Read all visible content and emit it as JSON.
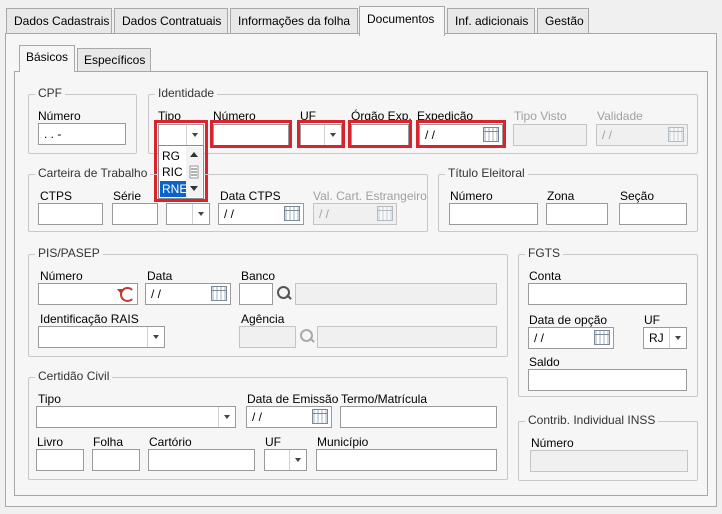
{
  "tabs": [
    {
      "label": "Dados Cadastrais"
    },
    {
      "label": "Dados Contratuais"
    },
    {
      "label": "Informações da folha"
    },
    {
      "label": "Documentos"
    },
    {
      "label": "Inf. adicionais"
    },
    {
      "label": "Gestão"
    }
  ],
  "active_tab": "Documentos",
  "subtabs": [
    {
      "label": "Básicos"
    },
    {
      "label": "Específicos"
    }
  ],
  "active_subtab": "Básicos",
  "cpf": {
    "title": "CPF",
    "numero_label": "Número",
    "numero_value": " .  .  -"
  },
  "identidade": {
    "title": "Identidade",
    "tipo_label": "Tipo",
    "tipo_value": "",
    "tipo_options": [
      "RG",
      "RIC",
      "RNE"
    ],
    "tipo_selected": "RNE",
    "numero_label": "Número",
    "numero_value": "",
    "uf_label": "UF",
    "uf_value": "",
    "orgao_label": "Órgão Exp.",
    "orgao_value": "",
    "expedicao_label": "Expedição",
    "expedicao_value": "/ /",
    "tipo_visto_label": "Tipo Visto",
    "tipo_visto_value": "",
    "validade_label": "Validade",
    "validade_value": "/ /"
  },
  "carteira": {
    "title": "Carteira de Trabalho",
    "ctps_label": "CTPS",
    "ctps_value": "",
    "serie_label": "Série",
    "serie_value": "",
    "uf_value": "",
    "data_ctps_label": "Data CTPS",
    "data_ctps_value": "/ /",
    "val_cart_label": "Val. Cart. Estrangeiro",
    "val_cart_value": "/ /"
  },
  "titulo": {
    "title": "Título Eleitoral",
    "numero_label": "Número",
    "numero_value": "",
    "zona_label": "Zona",
    "zona_value": "",
    "secao_label": "Seção",
    "secao_value": ""
  },
  "pis": {
    "title": "PIS/PASEP",
    "numero_label": "Número",
    "numero_value": "",
    "data_label": "Data",
    "data_value": "/ /",
    "banco_label": "Banco",
    "banco_code": "",
    "banco_name": "",
    "rais_label": "Identificação RAIS",
    "rais_value": "",
    "agencia_label": "Agência",
    "agencia_code": "",
    "agencia_name": ""
  },
  "fgts": {
    "title": "FGTS",
    "conta_label": "Conta",
    "conta_value": "",
    "data_opcao_label": "Data de opção",
    "data_opcao_value": "/ /",
    "uf_label": "UF",
    "uf_value": "RJ",
    "saldo_label": "Saldo",
    "saldo_value": ""
  },
  "certidao": {
    "title": "Certidão Civil",
    "tipo_label": "Tipo",
    "tipo_value": "",
    "data_emissao_label": "Data de Emissão",
    "data_emissao_value": "/ /",
    "termo_label": "Termo/Matrícula",
    "termo_value": "",
    "livro_label": "Livro",
    "livro_value": "",
    "folha_label": "Folha",
    "folha_value": "",
    "cartorio_label": "Cartório",
    "cartorio_value": "",
    "uf_label": "UF",
    "uf_value": "",
    "municipio_label": "Município",
    "municipio_value": ""
  },
  "inss": {
    "title": "Contrib. Individual INSS",
    "numero_label": "Número",
    "numero_value": ""
  },
  "highlight_color": "#d9232e",
  "selection_color": "#0a64c8"
}
